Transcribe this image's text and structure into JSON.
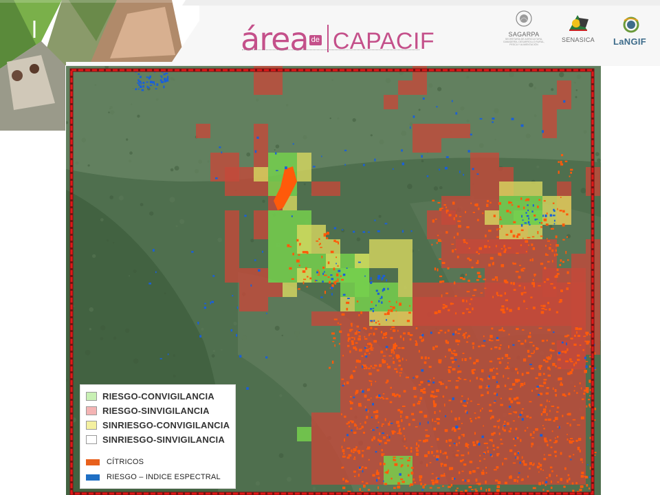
{
  "header": {
    "brand_area": "área",
    "brand_de": "de",
    "brand_capacif": "CAPACIF",
    "logos": [
      {
        "name": "SAGARPA",
        "subtitle": "SECRETARÍA DE AGRICULTURA, GANADERÍA, DESARROLLO RURAL, PESCA Y ALIMENTACIÓN"
      },
      {
        "name": "SENASICA",
        "subtitle": ""
      },
      {
        "name": "LaNGIF",
        "subtitle": ""
      }
    ]
  },
  "legend": {
    "items": [
      {
        "label": "RIESGO-CONVIGILANCIA",
        "color": "#c8f0b4"
      },
      {
        "label": "RIESGO-SINVIGILANCIA",
        "color": "#f4b4b4"
      },
      {
        "label": "SINRIESGO-CONVIGILANCIA",
        "color": "#f4f0a0"
      },
      {
        "label": "SINRIESGO-SINVIGILANCIA",
        "color": "#ffffff"
      }
    ],
    "layers": [
      {
        "label": "CÍTRICOS",
        "color": "#e8601c"
      },
      {
        "label": "RIESGO – INDICE ESPECTRAL",
        "color": "#1f6fc4"
      }
    ]
  },
  "colors": {
    "riesgo_convigilancia_fill": "#76d04e",
    "riesgo_sinvigilancia_fill": "#c4483a",
    "sinriesgo_convigilancia_fill": "#d8d860",
    "citricos": "#ff5a0a",
    "indice_espectral": "#1a5fd8",
    "boundary": "#e01818",
    "accent": "#c4508a"
  }
}
